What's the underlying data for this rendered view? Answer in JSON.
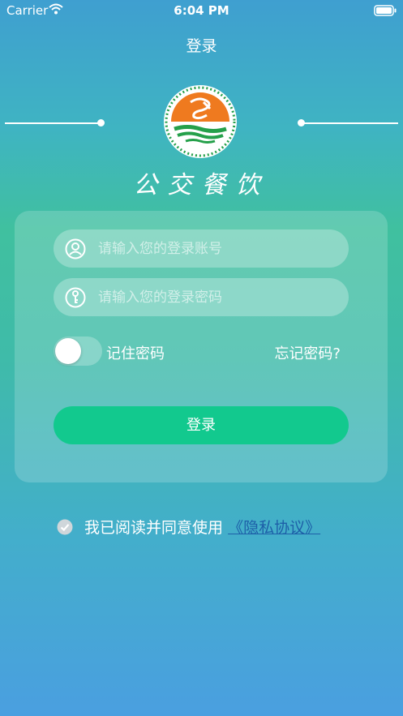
{
  "status_bar": {
    "carrier": "Carrier",
    "time": "6:04 PM"
  },
  "header": {
    "title": "登录"
  },
  "brand": {
    "name": "公交餐饮"
  },
  "form": {
    "account_placeholder": "请输入您的登录账号",
    "password_placeholder": "请输入您的登录密码",
    "remember_label": "记住密码",
    "remember_on": false,
    "forgot_label": "忘记密码?",
    "login_label": "登录"
  },
  "agreement": {
    "text": "我已阅读并同意使用",
    "link": "《隐私协议》",
    "checked": true
  },
  "colors": {
    "primary": "#12c98e",
    "link": "#1d5fa8",
    "logo_orange": "#ef7a1f",
    "logo_green": "#25a04a"
  },
  "icons": [
    "wifi-icon",
    "battery-icon",
    "user-icon",
    "key-icon",
    "check-icon"
  ]
}
